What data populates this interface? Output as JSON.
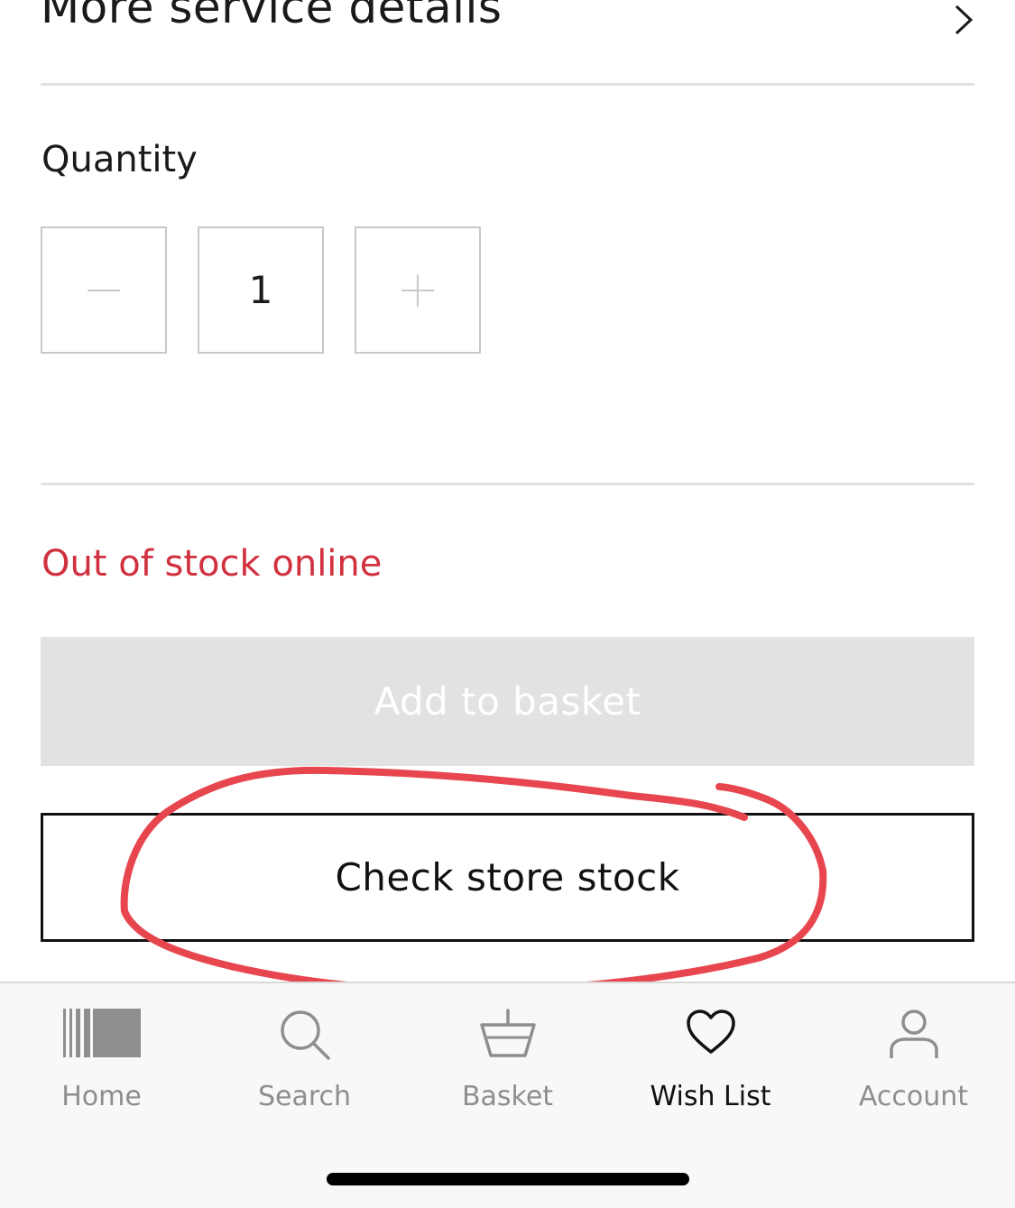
{
  "service": {
    "title": "More service details",
    "chevron_icon": "chevron-right-icon"
  },
  "quantity": {
    "label": "Quantity",
    "value": "1",
    "decrement_icon": "minus-icon",
    "increment_icon": "plus-icon"
  },
  "stock": {
    "status": "Out of stock online",
    "status_color": "#d1303e"
  },
  "actions": {
    "add_to_basket": "Add to basket",
    "check_store_stock": "Check store stock"
  },
  "annotation": {
    "color": "#e8464f",
    "shape": "hand-drawn-circle"
  },
  "tabbar": {
    "items": [
      {
        "label": "Home",
        "icon": "home-barcode-icon",
        "active": false
      },
      {
        "label": "Search",
        "icon": "search-icon",
        "active": false
      },
      {
        "label": "Basket",
        "icon": "basket-icon",
        "active": false
      },
      {
        "label": "Wish List",
        "icon": "heart-icon",
        "active": true
      },
      {
        "label": "Account",
        "icon": "person-icon",
        "active": false
      }
    ]
  }
}
